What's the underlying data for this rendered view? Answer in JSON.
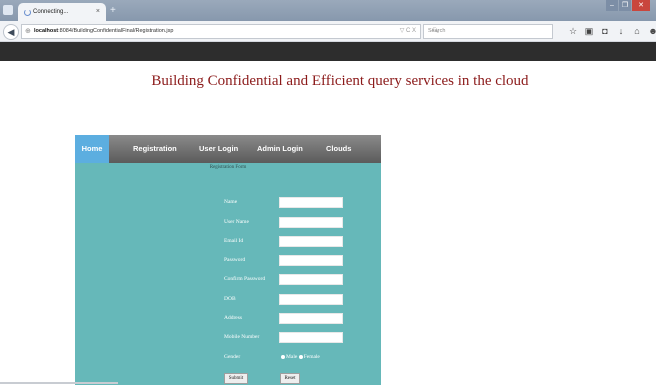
{
  "browser": {
    "tab_title": "Connecting...",
    "tab_close": "×",
    "new_tab": "+",
    "url_host": "localhost",
    "url_rest": ":8084/BuildingConfidentialFinal/Registration.jsp",
    "url_right": "▽ C X",
    "search_placeholder": "Search",
    "window_buttons": [
      "–",
      "❐",
      "✕"
    ]
  },
  "page": {
    "heading": "Building Confidential and Efficient query services in the cloud"
  },
  "menu": {
    "items": [
      "Home",
      "Registration",
      "User Login",
      "Admin Login",
      "Clouds"
    ]
  },
  "form": {
    "title": "Registration Form",
    "fields": [
      "Name",
      "User Name",
      "Email Id",
      "Password",
      "Confirm Password",
      "DOB",
      "Address",
      "Mobile Number"
    ],
    "gender_label": "Gender",
    "gender_options": [
      "Male",
      "Female"
    ],
    "submit_label": "Submit",
    "reset_label": "Reset"
  },
  "colors": {
    "panel": "#66b8b9",
    "heading": "#8b1a1a",
    "home_active": "#5caee0"
  }
}
